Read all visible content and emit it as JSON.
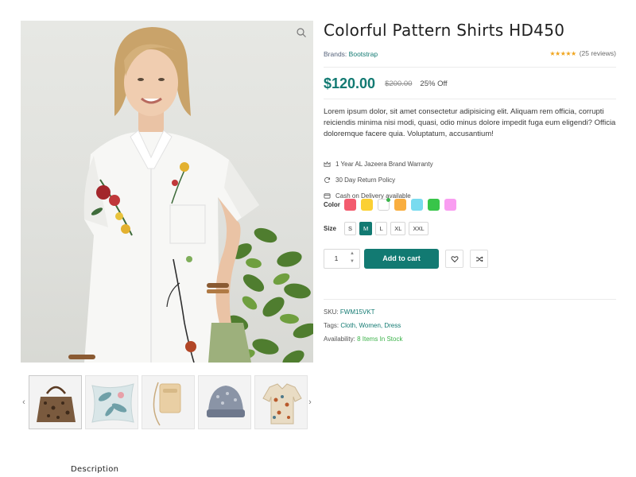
{
  "product": {
    "title": "Colorful Pattern Shirts HD450",
    "brand_label": "Brands:",
    "brand_name": "Bootstrap",
    "rating_stars": 4.5,
    "reviews_text": "(25 reviews)",
    "price": "$120.00",
    "old_price": "$200.00",
    "discount": "25% Off",
    "description": "Lorem ipsum dolor, sit amet consectetur adipisicing elit. Aliquam rem officia, corrupti reiciendis minima nisi modi, quasi, odio minus dolore impedit fuga eum eligendi? Officia doloremque facere quia. Voluptatum, accusantium!"
  },
  "features": [
    {
      "icon": "crown-icon",
      "text": "1 Year AL Jazeera Brand Warranty"
    },
    {
      "icon": "refresh-icon",
      "text": "30 Day Return Policy"
    },
    {
      "icon": "credit-card-icon",
      "text": "Cash on Delivery available"
    }
  ],
  "color_option": {
    "label": "Color",
    "swatches": [
      "#f35b6e",
      "#fbd033",
      "#ffffff",
      "#f9ae3f",
      "#79dbef",
      "#38c549",
      "#f99df1"
    ],
    "selected_index": 2
  },
  "size_option": {
    "label": "Size",
    "sizes": [
      "S",
      "M",
      "L",
      "XL",
      "XXL"
    ],
    "selected": "M"
  },
  "cart": {
    "quantity": "1",
    "add_label": "Add to cart"
  },
  "meta": {
    "sku_label": "SKU:",
    "sku": "FWM15VKT",
    "tags_label": "Tags:",
    "tags": "Cloth, Women, Dress",
    "availability_label": "Availability:",
    "availability": "8 Items In Stock"
  },
  "gallery": {
    "thumbnails": [
      "handbag",
      "floral-cushion",
      "beige-crossbody-bag",
      "knit-beanie",
      "patterned-shirt"
    ]
  },
  "tabs": {
    "description": "Description"
  },
  "colors": {
    "accent": "#127a72",
    "star": "#f0a51e",
    "stock": "#3cb34a"
  }
}
